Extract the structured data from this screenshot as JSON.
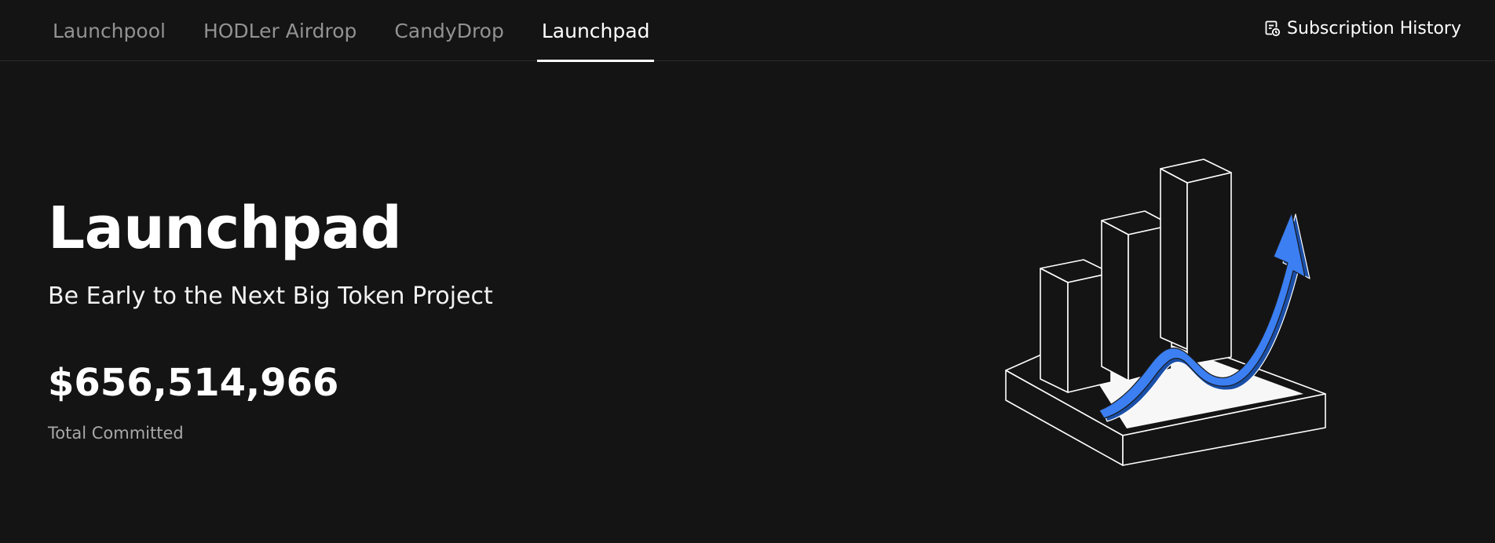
{
  "nav": {
    "tabs": [
      {
        "label": "Launchpool",
        "active": false
      },
      {
        "label": "HODLer Airdrop",
        "active": false
      },
      {
        "label": "CandyDrop",
        "active": false
      },
      {
        "label": "Launchpad",
        "active": true
      }
    ],
    "subscription_history": {
      "label": "Subscription History",
      "icon": "document-clock-icon"
    }
  },
  "hero": {
    "title": "Launchpad",
    "subtitle": "Be Early to the Next Big Token Project",
    "total_committed_value": "$656,514,966",
    "total_committed_label": "Total Committed"
  },
  "illustration": {
    "icon": "bar-chart-growth-arrow-illustration",
    "arrow_color": "#3b7ff2"
  },
  "colors": {
    "background": "#141414",
    "text_primary": "#ffffff",
    "text_muted": "#929292",
    "accent_blue": "#3b7ff2"
  }
}
